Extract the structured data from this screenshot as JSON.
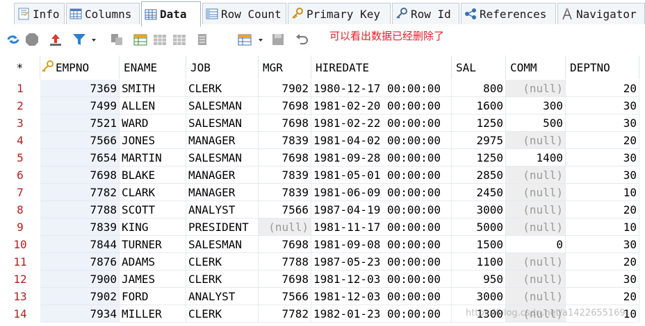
{
  "tabs": [
    {
      "label": "Info",
      "icon": "info-icon"
    },
    {
      "label": "Columns",
      "icon": "columns-icon"
    },
    {
      "label": "Data",
      "icon": "data-grid-icon",
      "active": true
    },
    {
      "label": "Row Count",
      "icon": "row-count-icon"
    },
    {
      "label": "Primary Key",
      "icon": "key-icon"
    },
    {
      "label": "Row Id",
      "icon": "row-id-icon"
    },
    {
      "label": "References",
      "icon": "references-icon"
    },
    {
      "label": "Navigator",
      "icon": "navigator-icon"
    }
  ],
  "toolbar": {
    "note": "可以看出数据已经删除了",
    "icons": [
      "refresh-icon",
      "stop-icon",
      "export-icon",
      "filter-icon",
      "filter-dropdown-icon",
      "copy-icon",
      "add-row-icon",
      "table-icon",
      "table-gray-icon",
      "delete-row-icon",
      "grid-options-icon",
      "grid-dropdown-icon",
      "save-icon",
      "undo-icon"
    ],
    "accent": "#e0202a"
  },
  "grid": {
    "corner": "*",
    "null_text": "(null)",
    "columns": [
      "EMPNO",
      "ENAME",
      "JOB",
      "MGR",
      "HIREDATE",
      "SAL",
      "COMM",
      "DEPTNO"
    ],
    "rows": [
      {
        "n": "1",
        "empno": "7369",
        "ename": "SMITH",
        "job": "CLERK",
        "mgr": "7902",
        "hiredate": "1980-12-17 00:00:00",
        "sal": "800",
        "comm": null,
        "deptno": "20"
      },
      {
        "n": "2",
        "empno": "7499",
        "ename": "ALLEN",
        "job": "SALESMAN",
        "mgr": "7698",
        "hiredate": "1981-02-20 00:00:00",
        "sal": "1600",
        "comm": "300",
        "deptno": "30"
      },
      {
        "n": "3",
        "empno": "7521",
        "ename": "WARD",
        "job": "SALESMAN",
        "mgr": "7698",
        "hiredate": "1981-02-22 00:00:00",
        "sal": "1250",
        "comm": "500",
        "deptno": "30"
      },
      {
        "n": "4",
        "empno": "7566",
        "ename": "JONES",
        "job": "MANAGER",
        "mgr": "7839",
        "hiredate": "1981-04-02 00:00:00",
        "sal": "2975",
        "comm": null,
        "deptno": "20"
      },
      {
        "n": "5",
        "empno": "7654",
        "ename": "MARTIN",
        "job": "SALESMAN",
        "mgr": "7698",
        "hiredate": "1981-09-28 00:00:00",
        "sal": "1250",
        "comm": "1400",
        "deptno": "30"
      },
      {
        "n": "6",
        "empno": "7698",
        "ename": "BLAKE",
        "job": "MANAGER",
        "mgr": "7839",
        "hiredate": "1981-05-01 00:00:00",
        "sal": "2850",
        "comm": null,
        "deptno": "30"
      },
      {
        "n": "7",
        "empno": "7782",
        "ename": "CLARK",
        "job": "MANAGER",
        "mgr": "7839",
        "hiredate": "1981-06-09 00:00:00",
        "sal": "2450",
        "comm": null,
        "deptno": "10"
      },
      {
        "n": "8",
        "empno": "7788",
        "ename": "SCOTT",
        "job": "ANALYST",
        "mgr": "7566",
        "hiredate": "1987-04-19 00:00:00",
        "sal": "3000",
        "comm": null,
        "deptno": "20"
      },
      {
        "n": "9",
        "empno": "7839",
        "ename": "KING",
        "job": "PRESIDENT",
        "mgr": null,
        "hiredate": "1981-11-17 00:00:00",
        "sal": "5000",
        "comm": null,
        "deptno": "10"
      },
      {
        "n": "10",
        "empno": "7844",
        "ename": "TURNER",
        "job": "SALESMAN",
        "mgr": "7698",
        "hiredate": "1981-09-08 00:00:00",
        "sal": "1500",
        "comm": "0",
        "deptno": "30"
      },
      {
        "n": "11",
        "empno": "7876",
        "ename": "ADAMS",
        "job": "CLERK",
        "mgr": "7788",
        "hiredate": "1987-05-23 00:00:00",
        "sal": "1100",
        "comm": null,
        "deptno": "20"
      },
      {
        "n": "12",
        "empno": "7900",
        "ename": "JAMES",
        "job": "CLERK",
        "mgr": "7698",
        "hiredate": "1981-12-03 00:00:00",
        "sal": "950",
        "comm": null,
        "deptno": "30"
      },
      {
        "n": "13",
        "empno": "7902",
        "ename": "FORD",
        "job": "ANALYST",
        "mgr": "7566",
        "hiredate": "1981-12-03 00:00:00",
        "sal": "3000",
        "comm": null,
        "deptno": "20"
      },
      {
        "n": "14",
        "empno": "7934",
        "ename": "MILLER",
        "job": "CLERK",
        "mgr": "7782",
        "hiredate": "1982-01-23 00:00:00",
        "sal": "1300",
        "comm": null,
        "deptno": "10"
      }
    ]
  },
  "watermark": "https://blog.csdn.net/a1422655169"
}
